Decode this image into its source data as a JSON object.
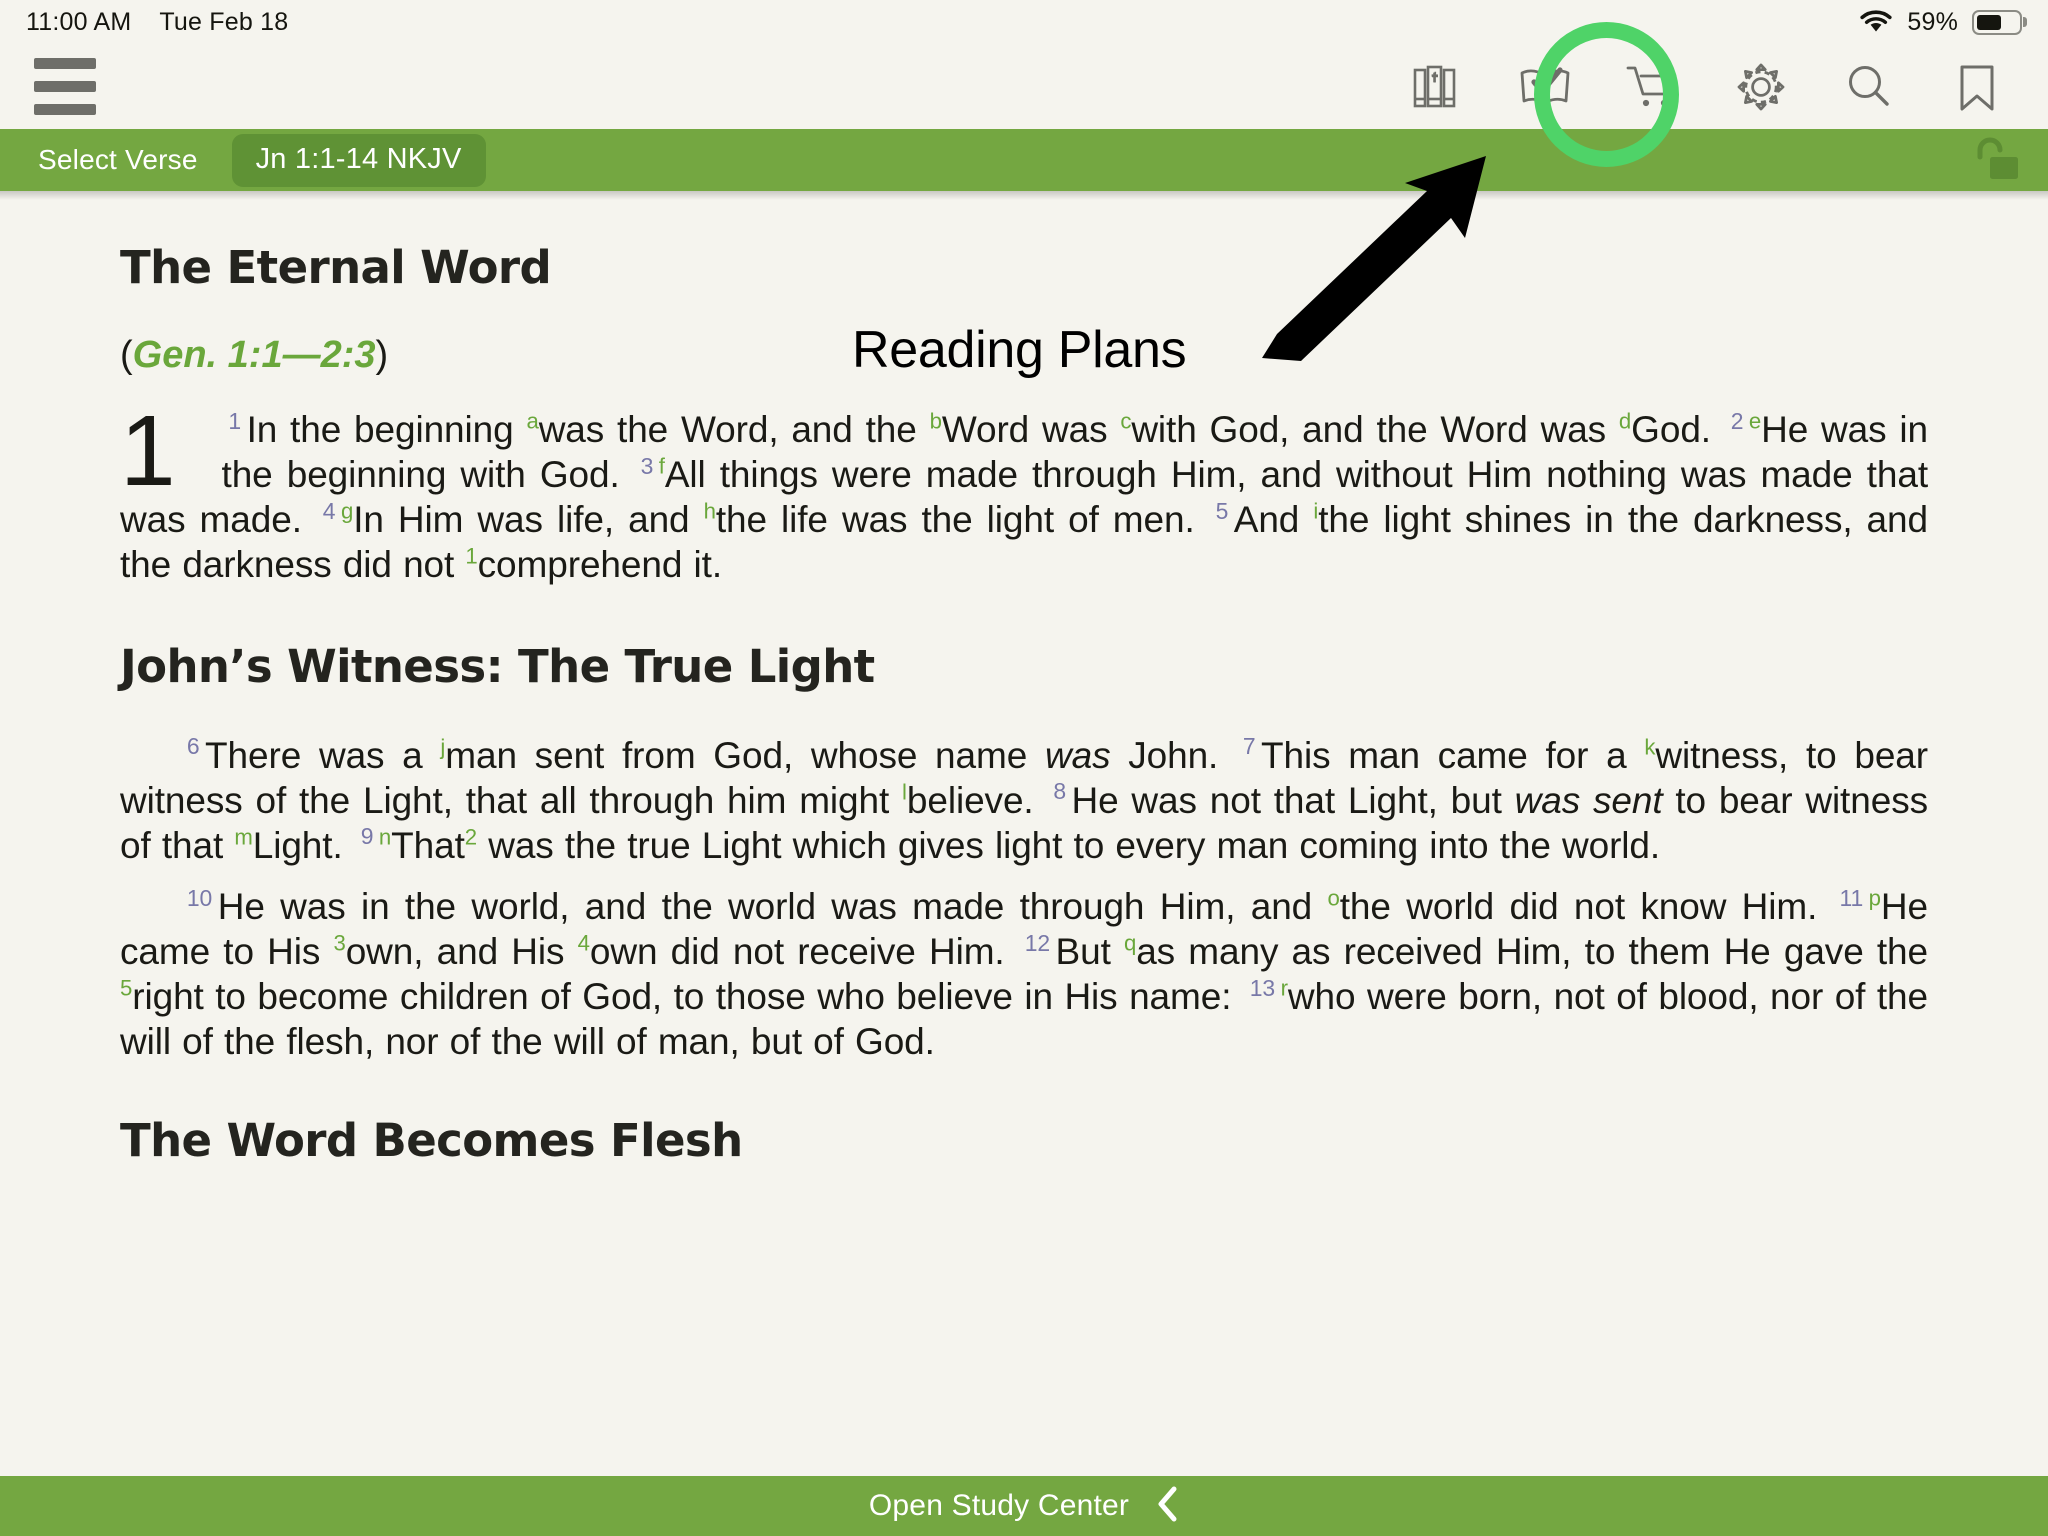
{
  "status_bar": {
    "time": "11:00 AM",
    "date": "Tue Feb 18",
    "battery_percent": "59%",
    "wifi_icon": "wifi-icon",
    "battery_icon": "battery-icon"
  },
  "toolbar": {
    "menu_icon": "hamburger-menu-icon",
    "icons": [
      {
        "name": "library-icon",
        "label": "Library"
      },
      {
        "name": "reading-plans-icon",
        "label": "Reading Plans"
      },
      {
        "name": "store-cart-icon",
        "label": "Store"
      },
      {
        "name": "settings-gear-icon",
        "label": "Settings"
      },
      {
        "name": "search-icon",
        "label": "Search"
      },
      {
        "name": "bookmark-icon",
        "label": "Bookmark"
      }
    ],
    "highlighted_icon": "reading-plans-icon"
  },
  "verse_bar": {
    "select_verse_label": "Select Verse",
    "reference_pill": "Jn 1:1-14 NKJV",
    "lock_icon": "unlock-icon",
    "background_color": "#74a741",
    "pill_color": "#5f9235"
  },
  "annotation": {
    "text": "Reading Plans",
    "arrow_icon": "arrow-up-right-icon",
    "highlight_color": "#4fd368"
  },
  "content": {
    "heading_1": "The Eternal Word",
    "cross_reference_open": "(",
    "cross_reference": "Gen. 1:1—2:3",
    "cross_reference_close": ")",
    "chapter_number": "1",
    "paragraph_1": [
      {
        "type": "verse_num",
        "text": "1"
      },
      {
        "type": "text",
        "text": "In the beginning "
      },
      {
        "type": "footnote",
        "text": "a"
      },
      {
        "type": "text",
        "text": "was the Word, and the "
      },
      {
        "type": "footnote",
        "text": "b"
      },
      {
        "type": "text",
        "text": "Word was "
      },
      {
        "type": "footnote",
        "text": "c"
      },
      {
        "type": "text",
        "text": "with God, and the Word was "
      },
      {
        "type": "footnote",
        "text": "d"
      },
      {
        "type": "text",
        "text": "God. "
      },
      {
        "type": "verse_num",
        "text": "2"
      },
      {
        "type": "footnote",
        "text": "e"
      },
      {
        "type": "text",
        "text": "He was in the beginning with God. "
      },
      {
        "type": "verse_num",
        "text": "3"
      },
      {
        "type": "footnote",
        "text": "f"
      },
      {
        "type": "text",
        "text": "All things were made through Him, and without Him nothing was made that was made. "
      },
      {
        "type": "verse_num",
        "text": "4"
      },
      {
        "type": "footnote",
        "text": "g"
      },
      {
        "type": "text",
        "text": "In Him was life, and "
      },
      {
        "type": "footnote",
        "text": "h"
      },
      {
        "type": "text",
        "text": "the life was the light of men. "
      },
      {
        "type": "verse_num",
        "text": "5"
      },
      {
        "type": "text",
        "text": "And "
      },
      {
        "type": "footnote",
        "text": "i"
      },
      {
        "type": "text",
        "text": "the light shines in the darkness, and the darkness did not "
      },
      {
        "type": "footnote_num",
        "text": "1"
      },
      {
        "type": "text",
        "text": "comprehend it."
      }
    ],
    "heading_2": "John’s Witness: The True Light",
    "paragraph_2": [
      {
        "type": "verse_num",
        "text": "6"
      },
      {
        "type": "text",
        "text": "There was a "
      },
      {
        "type": "footnote",
        "text": "j"
      },
      {
        "type": "text",
        "text": "man sent from God, whose name "
      },
      {
        "type": "italic",
        "text": "was"
      },
      {
        "type": "text",
        "text": " John. "
      },
      {
        "type": "verse_num",
        "text": "7"
      },
      {
        "type": "text",
        "text": "This man came for a "
      },
      {
        "type": "footnote",
        "text": "k"
      },
      {
        "type": "text",
        "text": "witness, to bear witness of the Light, that all through him might "
      },
      {
        "type": "footnote",
        "text": "l"
      },
      {
        "type": "text",
        "text": "believe. "
      },
      {
        "type": "verse_num",
        "text": "8"
      },
      {
        "type": "text",
        "text": "He was not that Light, but "
      },
      {
        "type": "italic",
        "text": "was sent"
      },
      {
        "type": "text",
        "text": " to bear witness of that "
      },
      {
        "type": "footnote",
        "text": "m"
      },
      {
        "type": "text",
        "text": "Light. "
      },
      {
        "type": "verse_num",
        "text": "9"
      },
      {
        "type": "footnote",
        "text": "n"
      },
      {
        "type": "text",
        "text": "That"
      },
      {
        "type": "footnote_num",
        "text": "2"
      },
      {
        "type": "text",
        "text": " was the true Light which gives light to every man coming into the world."
      }
    ],
    "paragraph_3": [
      {
        "type": "verse_num",
        "text": "10"
      },
      {
        "type": "text",
        "text": "He was in the world, and the world was made through Him, and "
      },
      {
        "type": "footnote",
        "text": "o"
      },
      {
        "type": "text",
        "text": "the world did not know Him. "
      },
      {
        "type": "verse_num",
        "text": "11"
      },
      {
        "type": "footnote",
        "text": "p"
      },
      {
        "type": "text",
        "text": "He came to His "
      },
      {
        "type": "footnote_num",
        "text": "3"
      },
      {
        "type": "text",
        "text": "own, and His "
      },
      {
        "type": "footnote_num",
        "text": "4"
      },
      {
        "type": "text",
        "text": "own did not receive Him. "
      },
      {
        "type": "verse_num",
        "text": "12"
      },
      {
        "type": "text",
        "text": "But "
      },
      {
        "type": "footnote",
        "text": "q"
      },
      {
        "type": "text",
        "text": "as many as received Him, to them He gave the "
      },
      {
        "type": "footnote_num",
        "text": "5"
      },
      {
        "type": "text",
        "text": "right to become children of God, to those who believe in His name: "
      },
      {
        "type": "verse_num",
        "text": "13"
      },
      {
        "type": "footnote",
        "text": "r"
      },
      {
        "type": "text",
        "text": "who were born, not of blood, nor of the will of the flesh, nor of the will of man, but of God."
      }
    ],
    "heading_3": "The Word Becomes Flesh"
  },
  "bottom_bar": {
    "label": "Open Study Center",
    "chevron_icon": "chevron-left-icon"
  }
}
